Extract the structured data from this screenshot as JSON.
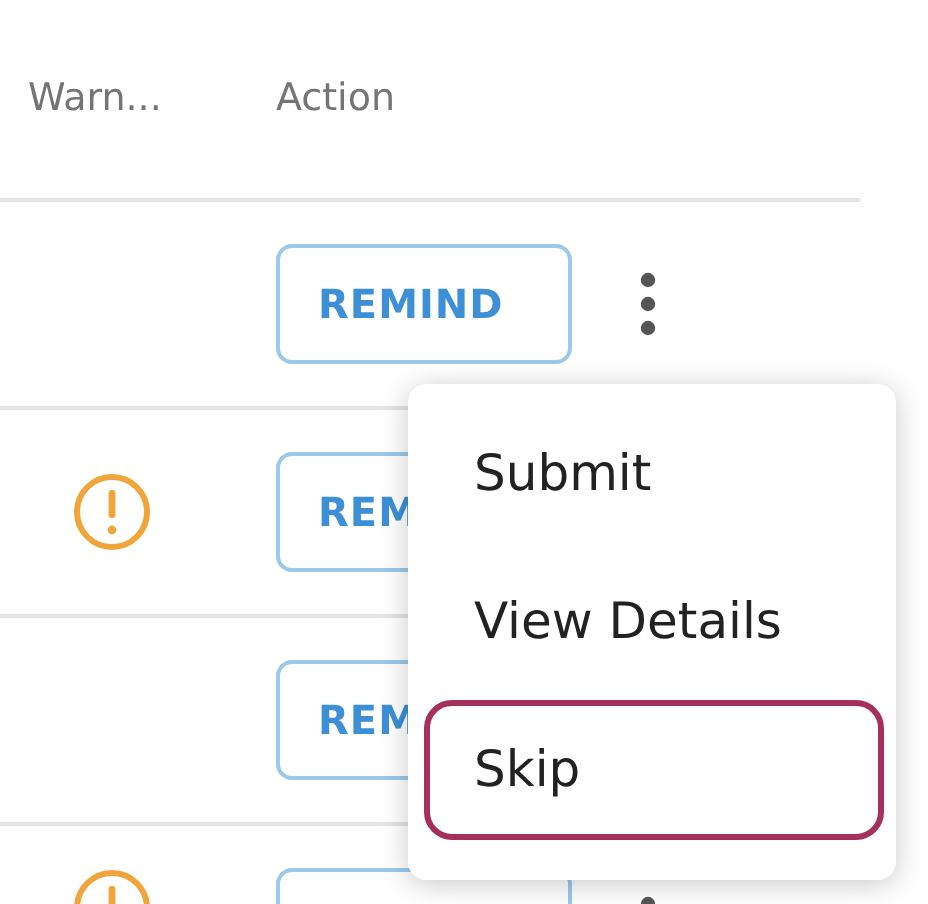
{
  "table": {
    "columns": [
      "Warn...",
      "Action"
    ],
    "rows": [
      {
        "warning": false,
        "action": "REMIND",
        "menu_button": true
      },
      {
        "warning": true,
        "action": "REM"
      },
      {
        "warning": false,
        "action": "REM"
      },
      {
        "warning": true,
        "menu_button": true
      }
    ]
  },
  "menu": {
    "items": [
      {
        "label": "Submit",
        "focused": false
      },
      {
        "label": "View Details",
        "focused": false
      },
      {
        "label": "Skip",
        "focused": true
      }
    ]
  }
}
